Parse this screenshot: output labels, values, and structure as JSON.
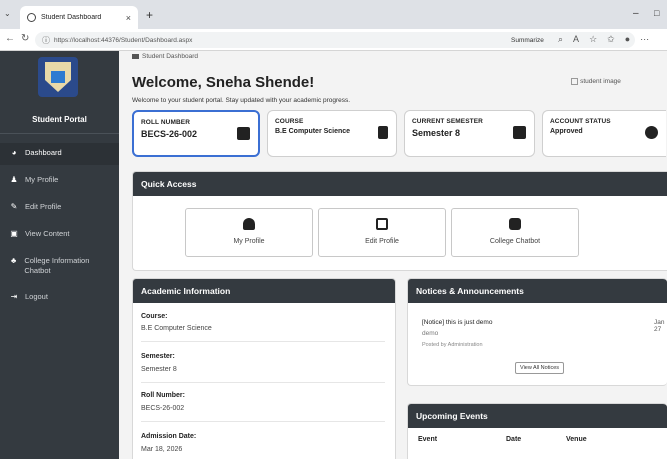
{
  "browser": {
    "tab_title": "Student Dashboard",
    "url": "https://localhost:44376/Student/Dashboard.aspx",
    "summarize_label": "Summarize"
  },
  "sidebar": {
    "portal_title": "Student Portal",
    "items": [
      {
        "label": "Dashboard",
        "icon": "dashboard-icon"
      },
      {
        "label": "My Profile",
        "icon": "user-icon"
      },
      {
        "label": "Edit Profile",
        "icon": "edit-icon"
      },
      {
        "label": "View Content",
        "icon": "content-icon"
      },
      {
        "label": "College Information Chatbot",
        "icon": "robot-icon"
      },
      {
        "label": "Logout",
        "icon": "logout-icon"
      }
    ]
  },
  "main": {
    "breadcrumb": "Student Dashboard",
    "welcome": "Welcome, Sneha Shende!",
    "subtitle": "Welcome to your student portal. Stay updated with your academic progress.",
    "student_image_alt": "student image"
  },
  "cards": [
    {
      "label": "ROLL NUMBER",
      "value": "BECS-26-002",
      "icon": "id-card-icon"
    },
    {
      "label": "COURSE",
      "value": "B.E Computer Science",
      "icon": "book-icon"
    },
    {
      "label": "CURRENT SEMESTER",
      "value": "Semester 8",
      "icon": "calendar-icon"
    },
    {
      "label": "ACCOUNT STATUS",
      "value": "Approved",
      "icon": "check-circle-icon"
    }
  ],
  "quick_access": {
    "title": "Quick Access",
    "tiles": [
      {
        "label": "My Profile",
        "icon": "user-icon"
      },
      {
        "label": "Edit Profile",
        "icon": "edit-icon"
      },
      {
        "label": "College Chatbot",
        "icon": "robot-icon"
      }
    ]
  },
  "academic": {
    "title": "Academic Information",
    "fields": [
      {
        "label": "Course:",
        "value": "B.E Computer Science"
      },
      {
        "label": "Semester:",
        "value": "Semester 8"
      },
      {
        "label": "Roll Number:",
        "value": "BECS-26-002"
      },
      {
        "label": "Admission Date:",
        "value": "Mar 18, 2026"
      }
    ]
  },
  "notices": {
    "title": "Notices & Announcements",
    "item_title": "[Notice] this is just demo",
    "item_date": "Jan 27",
    "item_body": "demo",
    "item_poster": "Posted by Administration",
    "view_all_label": "View All Notices"
  },
  "events": {
    "title": "Upcoming Events",
    "columns": [
      "Event",
      "Date",
      "Venue"
    ]
  }
}
